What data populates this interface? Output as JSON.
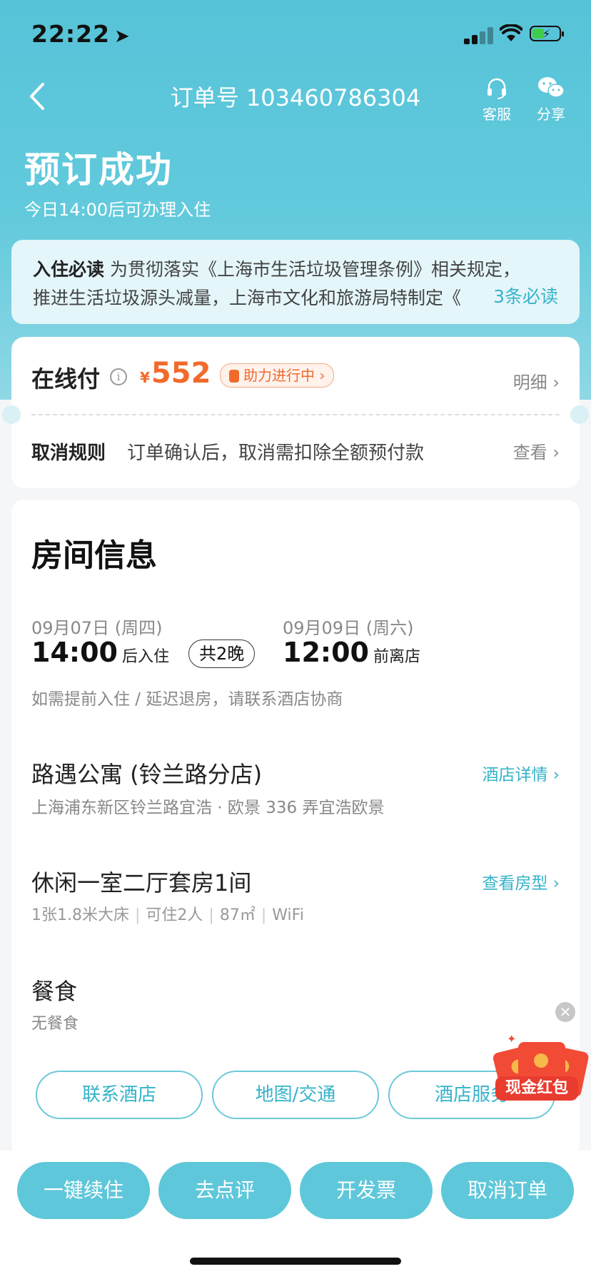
{
  "status_bar": {
    "time": "22:22"
  },
  "nav": {
    "title": "订单号 103460786304",
    "service_label": "客服",
    "share_label": "分享"
  },
  "hero": {
    "status": "预订成功",
    "checkin_tip": "今日14:00后可办理入住"
  },
  "notice": {
    "label": "入住必读",
    "line1": "为贯彻落实《上海市生活垃圾管理条例》相关规定，",
    "line2": "推进生活垃圾源头减量，上海市文化和旅游局特制定《",
    "more": "3条必读"
  },
  "payment": {
    "label": "在线付",
    "currency": "¥",
    "amount": "552",
    "boost_label": "助力进行中",
    "detail_link": "明细",
    "cancel_label": "取消规则",
    "cancel_text": "订单确认后，取消需扣除全额预付款",
    "cancel_link": "查看"
  },
  "room": {
    "title": "房间信息",
    "checkin_date": "09月07日 (周四)",
    "checkin_time": "14:00",
    "checkin_suffix": "后入住",
    "nights": "共2晚",
    "checkout_date": "09月09日 (周六)",
    "checkout_time": "12:00",
    "checkout_suffix": "前离店",
    "early_tip": "如需提前入住 / 延迟退房，请联系酒店协商",
    "hotel_name": "路遇公寓 (铃兰路分店)",
    "hotel_address": "上海浦东新区铃兰路宜浩 · 欧景 336 弄宜浩欧景",
    "hotel_link": "酒店详情",
    "room_name": "休闲一室二厅套房1间",
    "specs": [
      "1张1.8米大床",
      "可住2人",
      "87㎡",
      "WiFi"
    ],
    "room_link": "查看房型",
    "meal_label": "餐食",
    "meal_value": "无餐食",
    "actions": [
      "联系酒店",
      "地图/交通",
      "酒店服务"
    ]
  },
  "promo": {
    "label": "现金红包"
  },
  "bottom_actions": [
    "一键续住",
    "去点评",
    "开发票",
    "取消订单"
  ],
  "colors": {
    "accent": "#5fc7da",
    "price": "#f26a2b",
    "link": "#35b3ca"
  }
}
